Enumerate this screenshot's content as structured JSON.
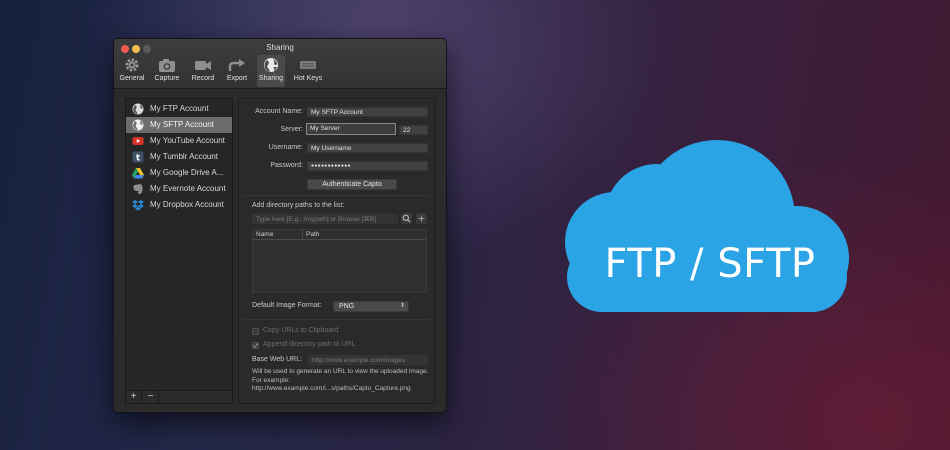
{
  "window": {
    "title": "Sharing"
  },
  "toolbar": {
    "items": [
      {
        "label": "General",
        "icon": "gear-icon"
      },
      {
        "label": "Capture",
        "icon": "camera-icon"
      },
      {
        "label": "Record",
        "icon": "video-camera-icon"
      },
      {
        "label": "Export",
        "icon": "export-arrow-icon"
      },
      {
        "label": "Sharing",
        "icon": "globe-icon",
        "active": true
      },
      {
        "label": "Hot Keys",
        "icon": "keyboard-icon"
      }
    ]
  },
  "accounts": [
    {
      "label": "My FTP Account",
      "icon": "globe-icon"
    },
    {
      "label": "My SFTP Account",
      "icon": "globe-icon",
      "selected": true
    },
    {
      "label": "My YouTube Account",
      "icon": "youtube-icon"
    },
    {
      "label": "My Tumblr Account",
      "icon": "tumblr-icon"
    },
    {
      "label": "My Google Drive A...",
      "icon": "google-drive-icon"
    },
    {
      "label": "My Evernote Account",
      "icon": "evernote-icon"
    },
    {
      "label": "My Dropbox Account",
      "icon": "dropbox-icon"
    }
  ],
  "sidebar_footer": {
    "add_label": "+",
    "remove_label": "−"
  },
  "form": {
    "account_name_label": "Account Name:",
    "account_name_value": "My SFTP Account",
    "server_label": "Server:",
    "server_value": "My Server",
    "port_value": "22",
    "username_label": "Username:",
    "username_value": "My Username",
    "password_label": "Password:",
    "password_value": "●●●●●●●●●●●●",
    "authenticate_label": "Authenticate Capto"
  },
  "paths": {
    "heading": "Add directory paths to the list:",
    "input_placeholder": "Type here [E.g.: /mypath] or Browse [⌘B]",
    "col_name": "Name",
    "col_path": "Path",
    "default_format_label": "Default Image Format:",
    "default_format_value": "PNG"
  },
  "urls": {
    "copy_urls_label": "Copy URLs to Clipboard",
    "append_path_label": "Append directory path to URL",
    "base_url_label": "Base Web URL:",
    "base_url_placeholder": "http://www.example.com/images",
    "help_text": "Will be used to generate an URL to view the uploaded image. For example: http://www.example.com/i...s/paths/Capto_Capture.png"
  },
  "banner": {
    "text": "FTP / SFTP"
  },
  "colors": {
    "cloud": "#2aa4e5",
    "selection": "#6c6c6d",
    "window_bg": "#2b2b2c"
  }
}
